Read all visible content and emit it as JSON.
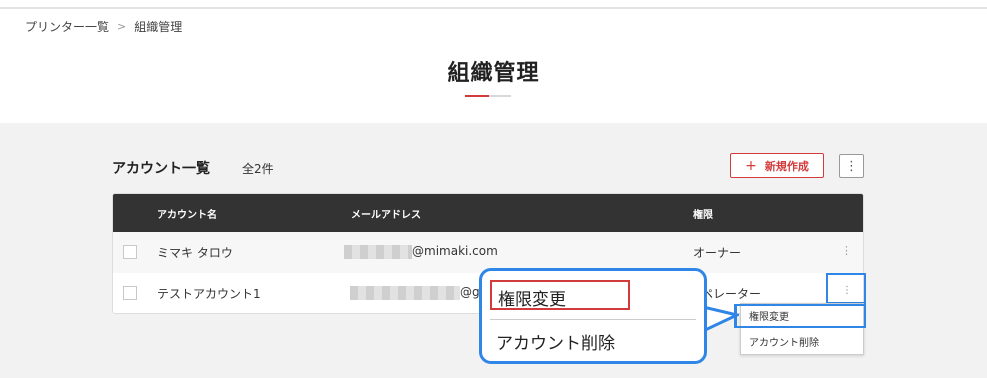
{
  "breadcrumb": {
    "items": [
      "プリンター一覧",
      "組織管理"
    ],
    "separator": ">"
  },
  "page": {
    "title": "組織管理"
  },
  "accounts": {
    "title": "アカウント一覧",
    "count": "全2件",
    "new_button": "新規作成",
    "new_button_icon": "plus-icon",
    "more_icon": "kebab-icon"
  },
  "table": {
    "headers": {
      "name": "アカウント名",
      "email": "メールアドレス",
      "role": "権限"
    },
    "rows": [
      {
        "name": "ミマキ タロウ",
        "email_suffix": "@mimaki.com",
        "role": "オーナー"
      },
      {
        "name": "テストアカウント1",
        "email_suffix": "@g",
        "role": "ペレーター"
      }
    ]
  },
  "menu": {
    "items": [
      "権限変更",
      "アカウント削除"
    ]
  },
  "callout": {
    "items": [
      "権限変更",
      "アカウント削除"
    ]
  },
  "colors": {
    "accent": "#d23b3b",
    "header_bg": "#333333",
    "highlight": "#2f86e6",
    "section_bg": "#f2f2f2"
  }
}
